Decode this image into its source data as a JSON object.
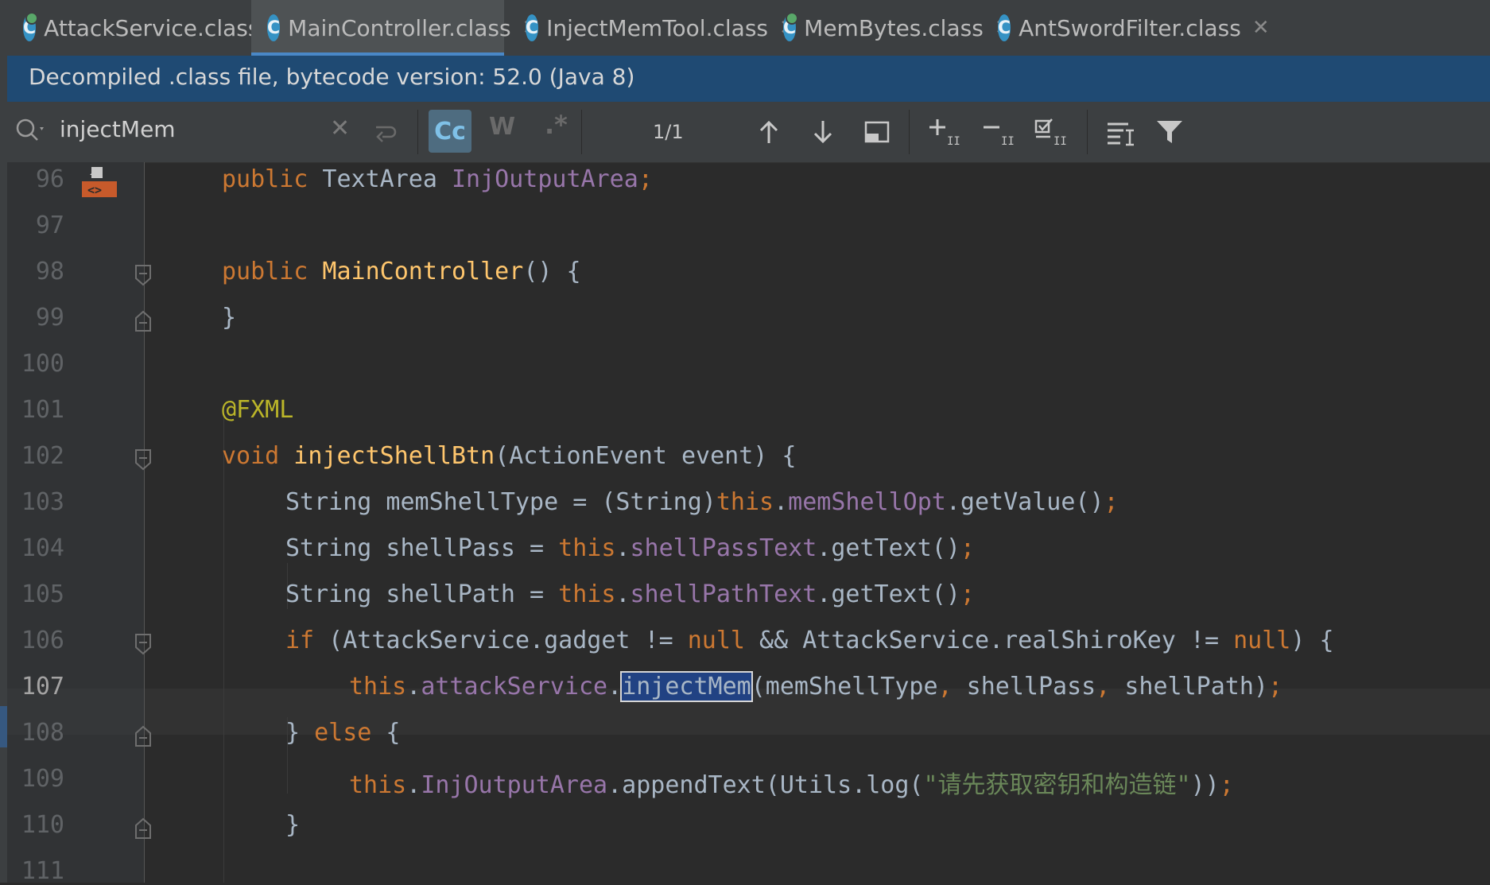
{
  "tabs": [
    {
      "label": "AttackService.class",
      "icon": "java-class-icon",
      "active": false
    },
    {
      "label": "MainController.class",
      "icon": "java-class-icon",
      "active": true
    },
    {
      "label": "InjectMemTool.class",
      "icon": "java-class-icon",
      "active": false
    },
    {
      "label": "MemBytes.class",
      "icon": "java-class-icon",
      "active": false
    },
    {
      "label": "AntSwordFilter.class",
      "icon": "java-class-icon",
      "active": false
    }
  ],
  "banner": {
    "text": "Decompiled .class file, bytecode version: 52.0 (Java 8)"
  },
  "search": {
    "query": "injectMem",
    "match_case": "Cc",
    "words": "W",
    "regex": ".*",
    "match_count": "1/1"
  },
  "editor": {
    "line_numbers": [
      "96",
      "97",
      "98",
      "99",
      "100",
      "101",
      "102",
      "103",
      "104",
      "105",
      "106",
      "107",
      "108",
      "109",
      "110",
      "111"
    ],
    "current_line": "107",
    "lines": {
      "l96": {
        "kw": "public",
        "type": " TextArea ",
        "field": "InjOutputArea",
        "end": ";"
      },
      "l98": {
        "kw": "public",
        "name": " MainController",
        "rest": "() {"
      },
      "l99": {
        "text": "}"
      },
      "l101": {
        "annotation": "@FXML"
      },
      "l102": {
        "kw": "void",
        "name": " injectShellBtn",
        "rest": "(ActionEvent event) {"
      },
      "l103": {
        "a": "String memShellType = (String)",
        "this": "this",
        "dot": ".",
        "field": "memShellOpt",
        "rest": ".getValue()",
        "end": ";"
      },
      "l104": {
        "a": "String shellPass = ",
        "this": "this",
        "dot": ".",
        "field": "shellPassText",
        "rest": ".getText()",
        "end": ";"
      },
      "l105": {
        "a": "String shellPath = ",
        "this": "this",
        "dot": ".",
        "field": "shellPathText",
        "rest": ".getText()",
        "end": ";"
      },
      "l106": {
        "kw": "if",
        "a": " (AttackService.gadget != ",
        "null1": "null",
        "b": " && AttackService.realShiroKey != ",
        "null2": "null",
        "c": ") {"
      },
      "l107": {
        "this": "this",
        "dot": ".",
        "field": "attackService",
        "dot2": ".",
        "match": "injectMem",
        "a": "(memShellType",
        "c1": ",",
        "b": " shellPass",
        "c2": ",",
        "c": " shellPath)",
        "end": ";"
      },
      "l108": {
        "a": "} ",
        "kw": "else",
        "b": " {"
      },
      "l109": {
        "this": "this",
        "dot": ".",
        "field": "InjOutputArea",
        "a": ".appendText(Utils.log(",
        "str": "\"请先获取密钥和构造链\"",
        "b": "))",
        "end": ";"
      },
      "l110": {
        "text": "}"
      }
    }
  },
  "colors": {
    "background": "#2b2b2b",
    "keyword": "#cc7832",
    "field": "#9876aa",
    "method": "#ffc66d",
    "string": "#6a8759",
    "annotation": "#bbb529",
    "banner": "#1f4a73",
    "search_highlight": "#214283"
  }
}
